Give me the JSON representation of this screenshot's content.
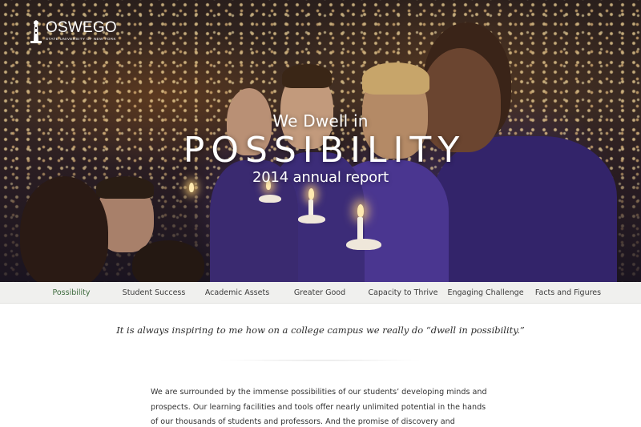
{
  "logo": {
    "name": "OSWEGO",
    "sub": "STATE UNIVERSITY OF NEW YORK"
  },
  "hero": {
    "kicker": "We Dwell in",
    "title": "POSSIBILITY",
    "subtitle": "2014 annual report"
  },
  "nav": {
    "items": [
      {
        "label": "Possibility",
        "active": true
      },
      {
        "label": "Student Success",
        "active": false
      },
      {
        "label": "Academic Assets",
        "active": false
      },
      {
        "label": "Greater Good",
        "active": false
      },
      {
        "label": "Capacity to Thrive",
        "active": false
      },
      {
        "label": "Engaging Challenge",
        "active": false
      },
      {
        "label": "Facts and Figures",
        "active": false
      }
    ]
  },
  "content": {
    "quote": "It is always inspiring to me how on a college campus we really do “dwell in possibility.”",
    "paragraph": "We are surrounded by the immense possibilities of our students’ developing minds and prospects. Our learning facilities and tools offer nearly unlimited potential in the hands of our thousands of students and professors. And the promise of discovery and innovation to improve the world beyond our doors"
  },
  "colors": {
    "nav_active": "#3e6b3e",
    "nav_bg": "#f0f0ee",
    "shirt_purple": "#3f2d7a"
  }
}
